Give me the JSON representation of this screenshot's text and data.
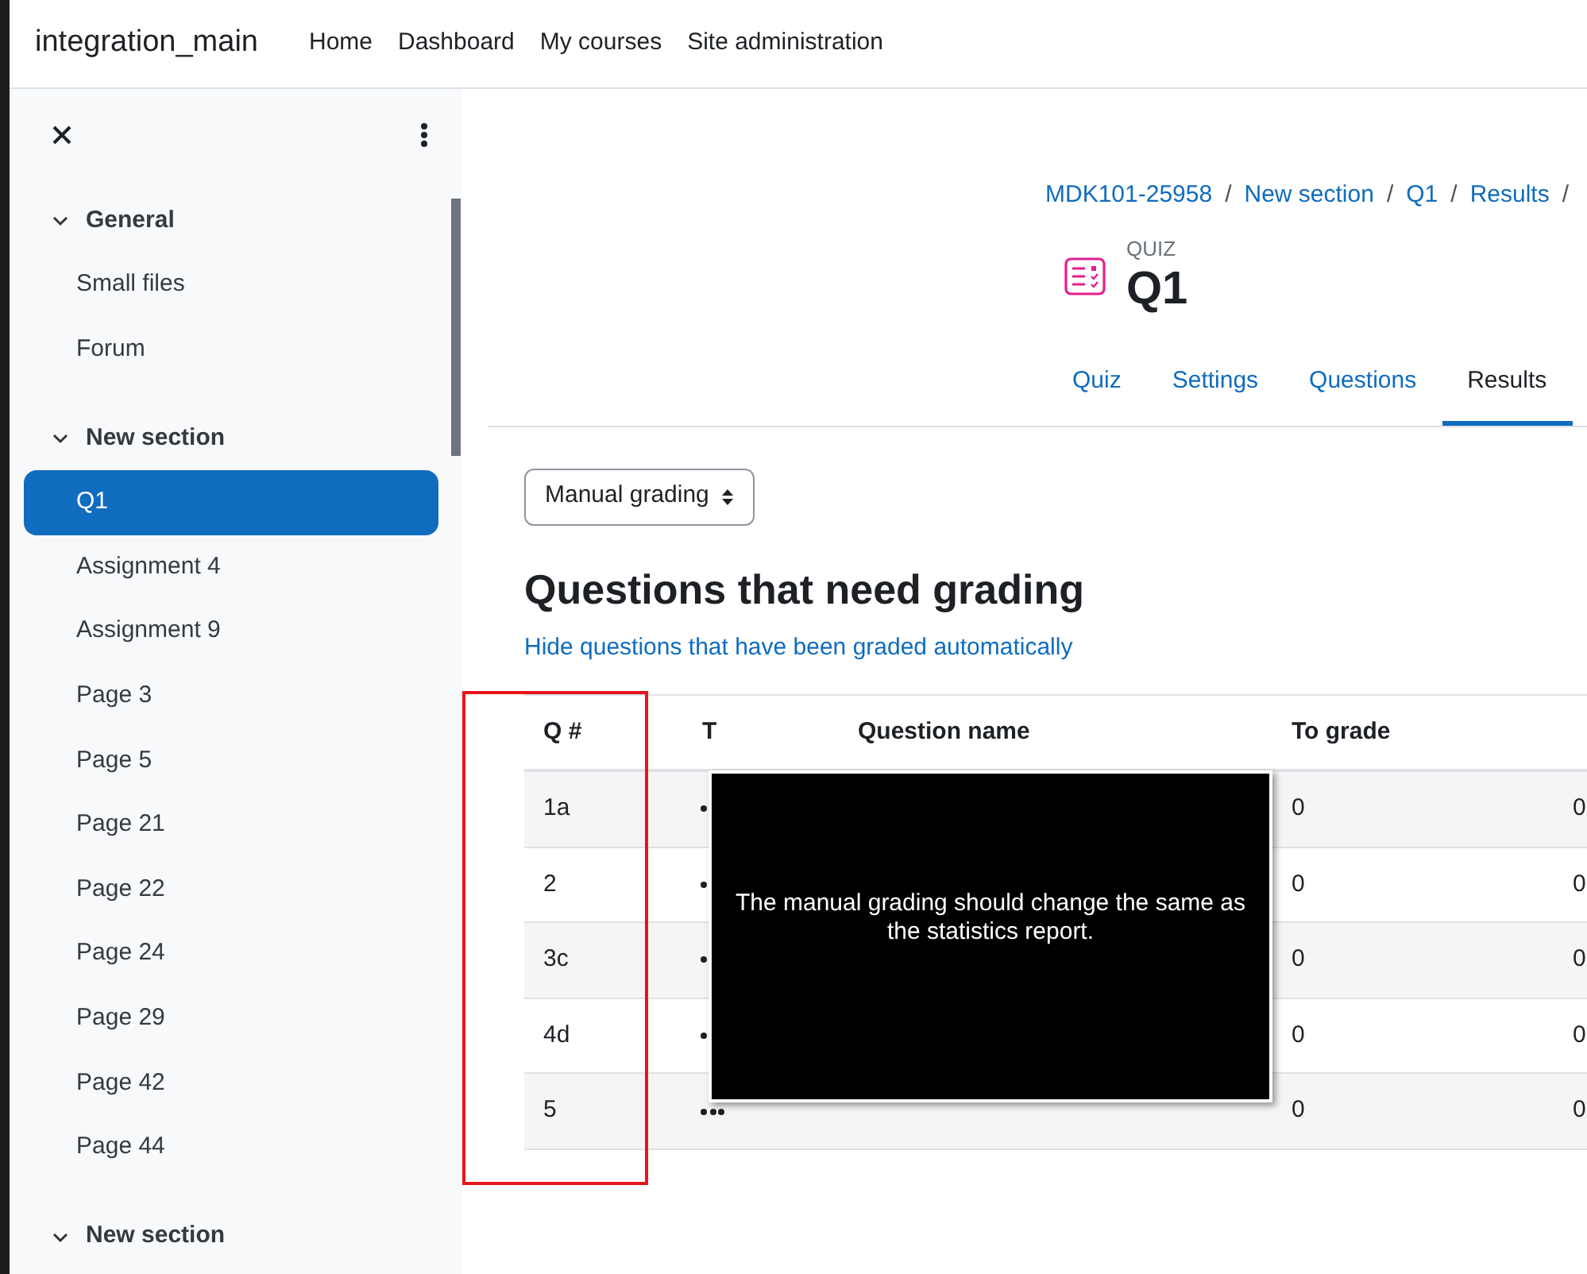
{
  "site_name": "integration_main",
  "nav": [
    "Home",
    "Dashboard",
    "My courses",
    "Site administration"
  ],
  "sidebar": {
    "items": [
      {
        "kind": "section",
        "label": "General",
        "expanded": true
      },
      {
        "kind": "item",
        "label": "Small files",
        "selected": false
      },
      {
        "kind": "item",
        "label": "Forum",
        "selected": false
      },
      {
        "kind": "section",
        "label": "New section",
        "expanded": true
      },
      {
        "kind": "item",
        "label": "Q1",
        "selected": true
      },
      {
        "kind": "item",
        "label": "Assignment 4",
        "selected": false
      },
      {
        "kind": "item",
        "label": "Assignment 9",
        "selected": false
      },
      {
        "kind": "item",
        "label": "Page 3",
        "selected": false
      },
      {
        "kind": "item",
        "label": "Page 5",
        "selected": false
      },
      {
        "kind": "item",
        "label": "Page 21",
        "selected": false
      },
      {
        "kind": "item",
        "label": "Page 22",
        "selected": false
      },
      {
        "kind": "item",
        "label": "Page 24",
        "selected": false
      },
      {
        "kind": "item",
        "label": "Page 29",
        "selected": false
      },
      {
        "kind": "item",
        "label": "Page 42",
        "selected": false
      },
      {
        "kind": "item",
        "label": "Page 44",
        "selected": false
      },
      {
        "kind": "section",
        "label": "New section",
        "expanded": true
      }
    ]
  },
  "breadcrumb": [
    "MDK101-25958",
    "New section",
    "Q1",
    "Results"
  ],
  "breadcrumb_separator": "/",
  "activity": {
    "type_label": "QUIZ",
    "title": "Q1"
  },
  "tabs": [
    {
      "label": "Quiz",
      "selected": false
    },
    {
      "label": "Settings",
      "selected": false
    },
    {
      "label": "Questions",
      "selected": false
    },
    {
      "label": "Results",
      "selected": true
    }
  ],
  "report_select": {
    "value": "Manual grading"
  },
  "heading": "Questions that need grading",
  "hide_link": "Hide questions that have been graded automatically",
  "table": {
    "columns": [
      "Q #",
      "T",
      "Question name",
      "To grade"
    ],
    "rows": [
      {
        "q": "1a",
        "to_grade": "0",
        "column_5": "0"
      },
      {
        "q": "2",
        "to_grade": "0",
        "column_5": "0"
      },
      {
        "q": "3c",
        "to_grade": "0",
        "column_5": "0"
      },
      {
        "q": "4d",
        "to_grade": "0",
        "column_5": "0"
      },
      {
        "q": "5",
        "to_grade": "0",
        "column_5": "0"
      }
    ]
  },
  "callout": {
    "text": "The manual grading should change the same as the statistics report."
  }
}
